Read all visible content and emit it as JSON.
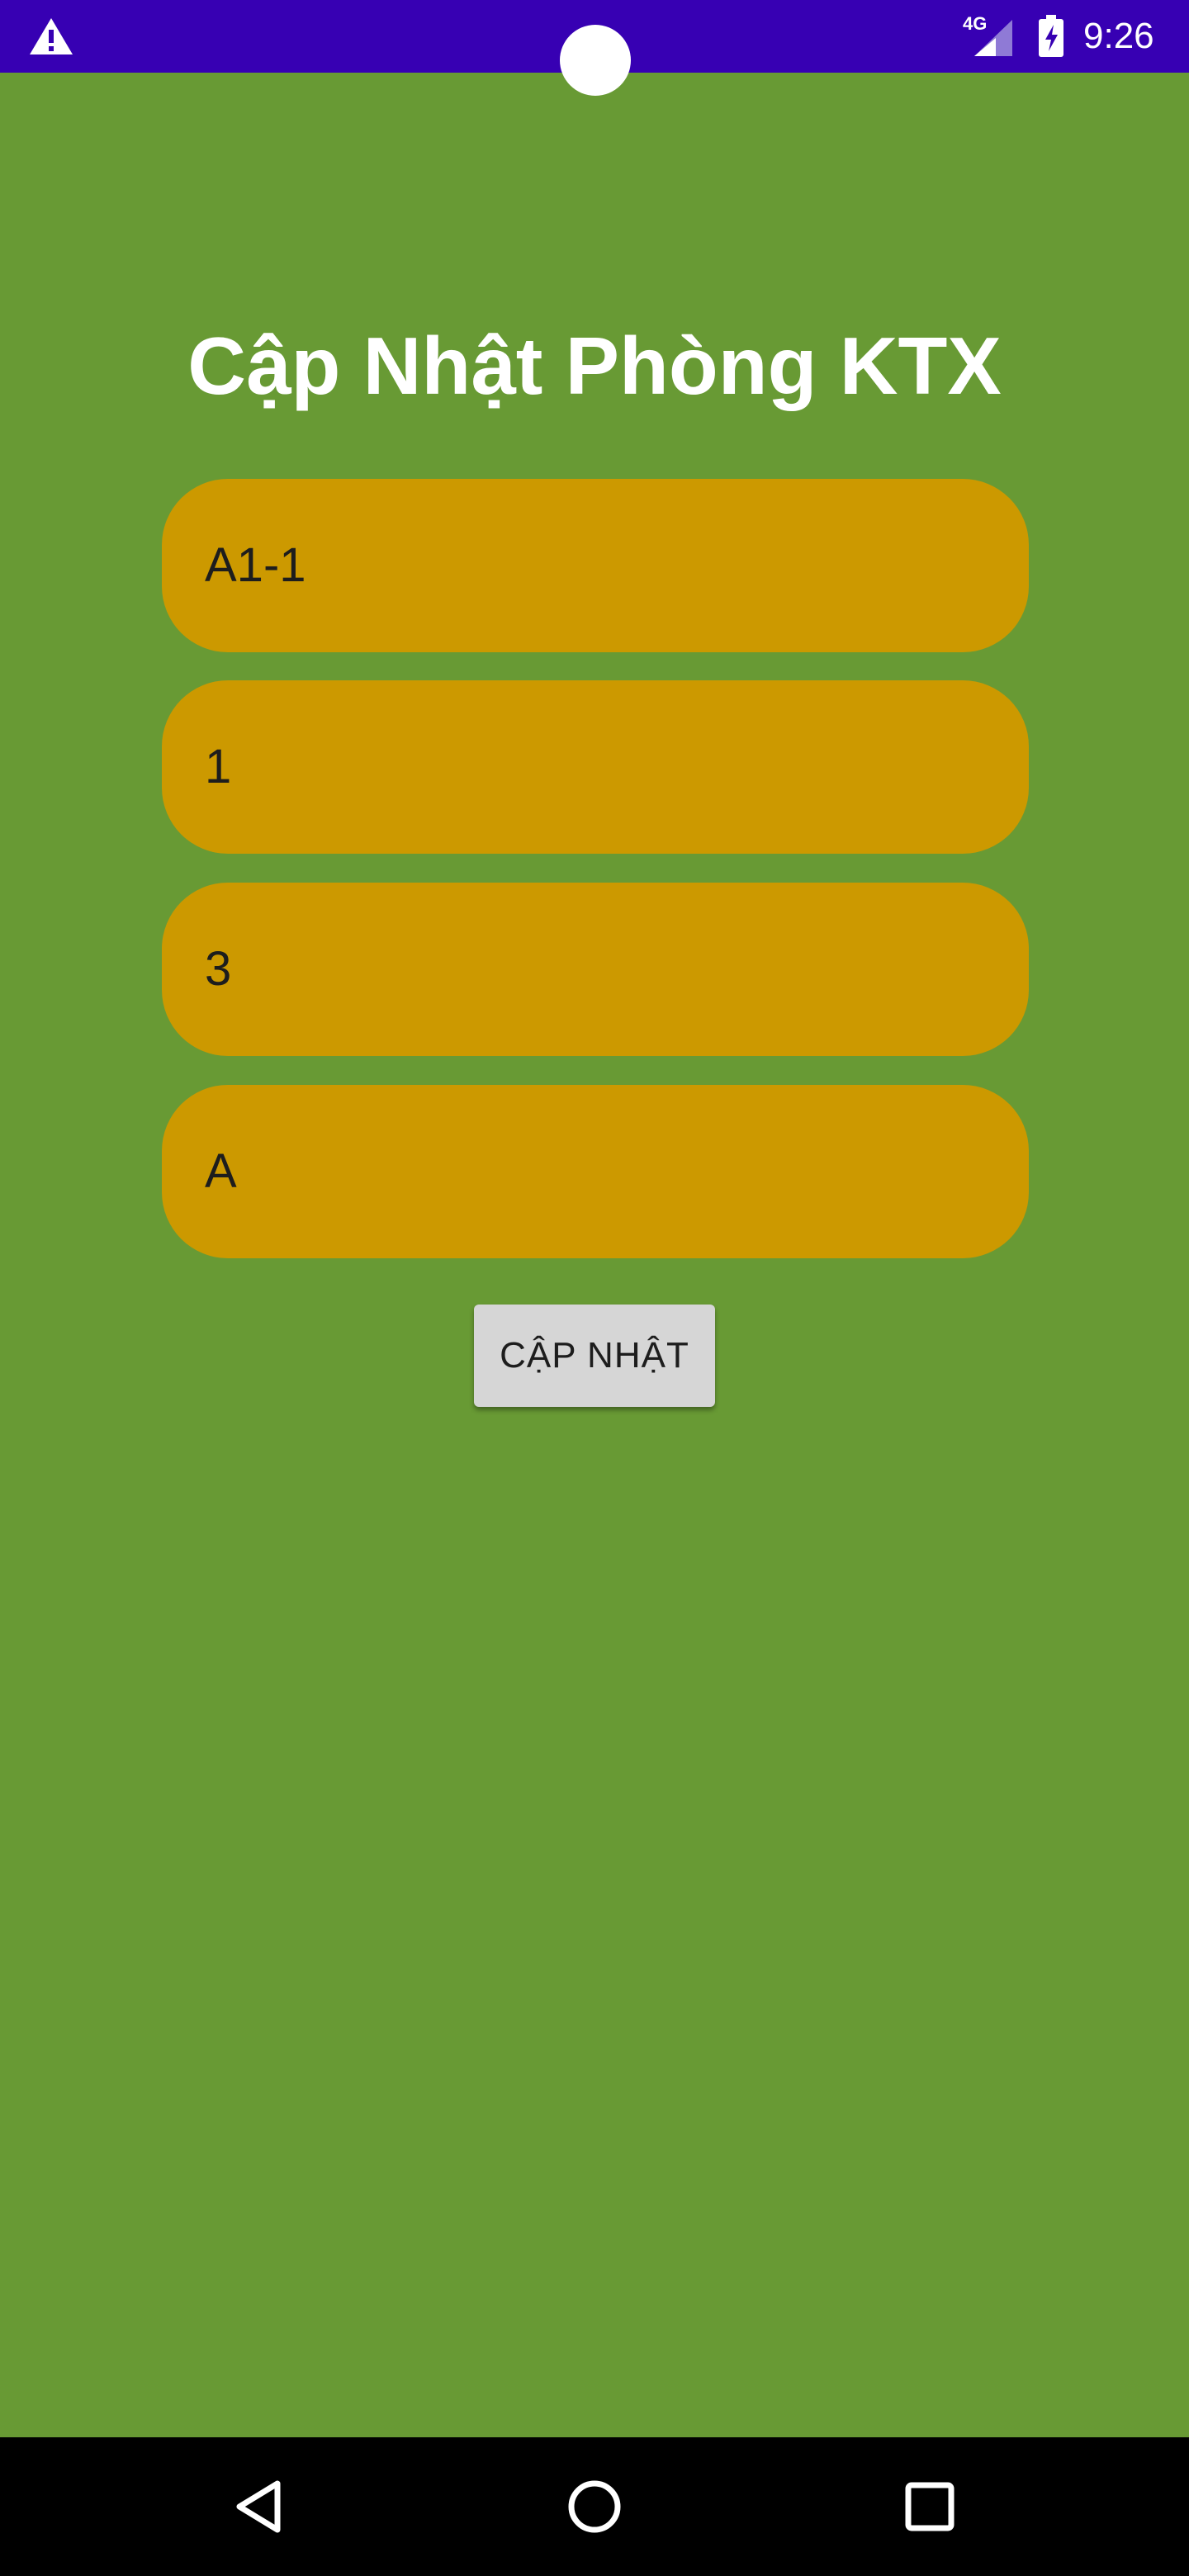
{
  "status_bar": {
    "warning_icon": "warning-icon",
    "network_type": "4G",
    "signal_icon": "cell-signal-icon",
    "battery_icon": "battery-charging-icon",
    "time": "9:26",
    "background_color": "#3700b3"
  },
  "screen": {
    "title": "Cập Nhật Phòng KTX",
    "background_color": "#689a34"
  },
  "form": {
    "field_color": "#cc9900",
    "fields": [
      {
        "value": "A1-1"
      },
      {
        "value": "1"
      },
      {
        "value": "3"
      },
      {
        "value": "A"
      }
    ],
    "update_button_label": "CẬP NHẬT"
  },
  "nav_bar": {
    "back_icon": "back-triangle-icon",
    "home_icon": "home-circle-icon",
    "recents_icon": "recents-square-icon"
  }
}
